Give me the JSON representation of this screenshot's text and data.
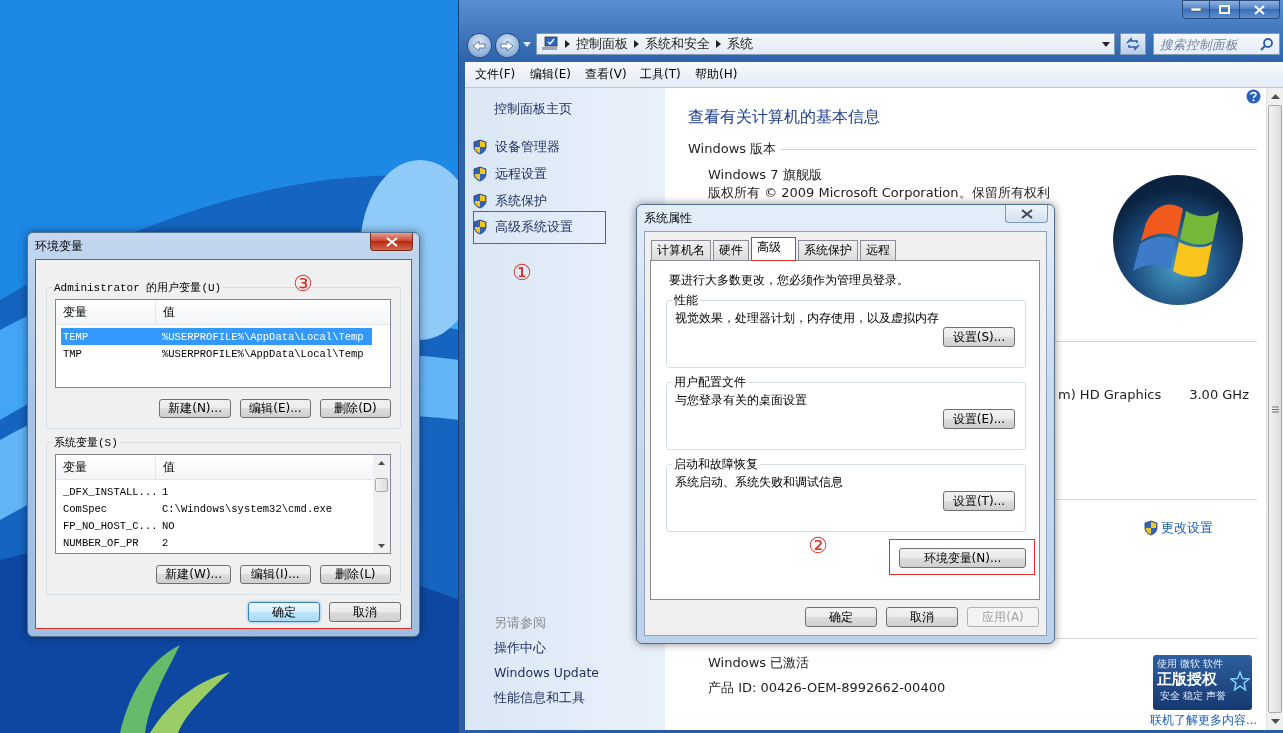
{
  "control_panel": {
    "breadcrumbs": [
      "控制面板",
      "系统和安全",
      "系统"
    ],
    "search": {
      "placeholder": "搜索控制面板"
    },
    "menu": [
      "文件(F)",
      "编辑(E)",
      "查看(V)",
      "工具(T)",
      "帮助(H)"
    ],
    "sidebar": {
      "home": "控制面板主页",
      "tasks": [
        {
          "label": "设备管理器",
          "marked": false
        },
        {
          "label": "远程设置",
          "marked": false
        },
        {
          "label": "系统保护",
          "marked": false
        },
        {
          "label": "高级系统设置",
          "marked": true
        }
      ],
      "see_also_title": "另请参阅",
      "see_also": [
        "操作中心",
        "Windows Update",
        "性能信息和工具"
      ]
    },
    "content": {
      "heading": "查看有关计算机的基本信息",
      "edition_title": "Windows 版本",
      "edition": "Windows 7 旗舰版",
      "copyright": "版权所有 © 2009 Microsoft Corporation。保留所有权利",
      "graphics": "m) HD Graphics",
      "speed": "3.00 GHz",
      "change_settings": "更改设置",
      "activation": "Windows 已激活",
      "product_id": "产品 ID: 00426-OEM-8992662-00400",
      "badge": {
        "top": "使用 微软 软件",
        "title": "正版授权",
        "subtitle": "安全 稳定 声誉"
      },
      "more_link": "联机了解更多内容..."
    }
  },
  "system_properties": {
    "title": "系统属性",
    "tabs": [
      {
        "label": "计算机名",
        "selected": false,
        "marked": false
      },
      {
        "label": "硬件",
        "selected": false,
        "marked": false
      },
      {
        "label": "高级",
        "selected": true,
        "marked": true
      },
      {
        "label": "系统保护",
        "selected": false,
        "marked": false
      },
      {
        "label": "远程",
        "selected": false,
        "marked": false
      }
    ],
    "notice": "要进行大多数更改，您必须作为管理员登录。",
    "groups": [
      {
        "title": "性能",
        "description": "视觉效果，处理器计划，内存使用，以及虚拟内存",
        "button": "设置(S)..."
      },
      {
        "title": "用户配置文件",
        "description": "与您登录有关的桌面设置",
        "button": "设置(E)..."
      },
      {
        "title": "启动和故障恢复",
        "description": "系统启动、系统失败和调试信息",
        "button": "设置(T)..."
      }
    ],
    "env_button": {
      "label": "环境变量(N)...",
      "marked": true
    },
    "buttons": [
      {
        "label": "确定",
        "disabled": false
      },
      {
        "label": "取消",
        "disabled": false
      },
      {
        "label": "应用(A)",
        "disabled": true
      }
    ]
  },
  "environment_variables": {
    "title": "环境变量",
    "marked": true,
    "user_group": {
      "title": "Administrator 的用户变量(U)",
      "columns": [
        "变量",
        "值"
      ],
      "rows": [
        {
          "name": "TEMP",
          "value": "%USERPROFILE%\\AppData\\Local\\Temp",
          "selected": true
        },
        {
          "name": "TMP",
          "value": "%USERPROFILE%\\AppData\\Local\\Temp",
          "selected": false
        }
      ],
      "buttons": [
        "新建(N)...",
        "编辑(E)...",
        "删除(D)"
      ]
    },
    "system_group": {
      "title": "系统变量(S)",
      "columns": [
        "变量",
        "值"
      ],
      "rows": [
        {
          "name": "_DFX_INSTALL...",
          "value": "1",
          "selected": false
        },
        {
          "name": "ComSpec",
          "value": "C:\\Windows\\system32\\cmd.exe",
          "selected": false
        },
        {
          "name": "FP_NO_HOST_C...",
          "value": "NO",
          "selected": false
        },
        {
          "name": "NUMBER_OF_PR",
          "value": "2",
          "selected": false
        }
      ],
      "buttons": [
        "新建(W)...",
        "编辑(I)...",
        "删除(L)"
      ]
    },
    "buttons": [
      {
        "label": "确定",
        "default": true
      },
      {
        "label": "取消",
        "default": false
      }
    ]
  },
  "annotations": [
    "①",
    "②",
    "③"
  ]
}
